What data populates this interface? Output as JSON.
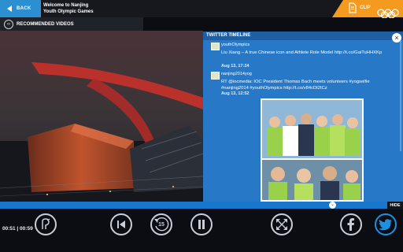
{
  "header": {
    "back_label": "BACK",
    "title_line1": "Welcome to Nanjing",
    "title_line2": "Youth Olympic Games",
    "clip_label": "CLIP"
  },
  "recommended": {
    "label": "RECOMMENDED VIDEOS"
  },
  "twitter": {
    "header": "TWITTER TIMELINE",
    "tweets": [
      {
        "user": "youthOlympics",
        "text": "Liu Xiang – A true Chinese icon and Athlete Role Model http://t.co/GaiTuHHXKp",
        "time": "Aug 13, 17:24"
      },
      {
        "user": "nanjing2014yog",
        "text": "RT @iocmedia: IOC President Thomas Bach meets volunteers #yogselfie #nanjing2014 #youthOlympics http://t.co/v84cDt2tCz",
        "time": "Aug 13, 12:52"
      }
    ]
  },
  "player": {
    "time_label": "00:51 | 00:59",
    "hide_label": "HIDE",
    "skip_seconds": "15"
  },
  "colors": {
    "accent": "#2c8fd1",
    "clip": "#f39a1f",
    "twitter_bg": "#2878c8"
  }
}
